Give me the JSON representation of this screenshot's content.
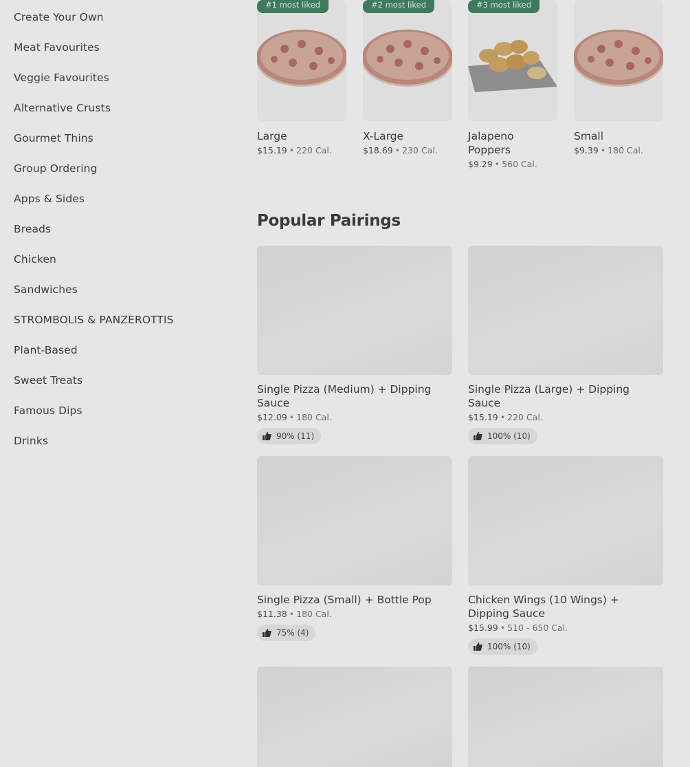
{
  "sidebar": {
    "items": [
      {
        "label": "Create Your Own"
      },
      {
        "label": "Meat Favourites"
      },
      {
        "label": "Veggie Favourites"
      },
      {
        "label": "Alternative Crusts"
      },
      {
        "label": "Gourmet Thins"
      },
      {
        "label": "Group Ordering"
      },
      {
        "label": "Apps & Sides"
      },
      {
        "label": "Breads"
      },
      {
        "label": "Chicken"
      },
      {
        "label": "Sandwiches"
      },
      {
        "label": "STROMBOLIS & PANZEROTTIS"
      },
      {
        "label": "Plant-Based"
      },
      {
        "label": "Sweet Treats"
      },
      {
        "label": "Famous Dips"
      },
      {
        "label": "Drinks"
      }
    ]
  },
  "most_liked": [
    {
      "badge": "#1 most liked",
      "name": "Large",
      "price": "$15.19",
      "cal": "220 Cal."
    },
    {
      "badge": "#2 most liked",
      "name": "X-Large",
      "price": "$18.69",
      "cal": "230 Cal."
    },
    {
      "badge": "#3 most liked",
      "name": "Jalapeno Poppers",
      "price": "$9.29",
      "cal": "560 Cal."
    },
    {
      "badge": "",
      "name": "Small",
      "price": "$9.39",
      "cal": "180 Cal."
    }
  ],
  "pairings": {
    "title": "Popular Pairings",
    "items": [
      {
        "name": "Single Pizza (Medium) + Dipping Sauce",
        "price": "$12.09",
        "cal": "180 Cal.",
        "rating": "90% (11)"
      },
      {
        "name": "Single Pizza (Large) + Dipping Sauce",
        "price": "$15.19",
        "cal": "220 Cal.",
        "rating": "100% (10)"
      },
      {
        "name": "Single Pizza (Small) + Bottle Pop",
        "price": "$11.38",
        "cal": "180 Cal.",
        "rating": "75% (4)"
      },
      {
        "name": "Chicken Wings (10 Wings) + Dipping Sauce",
        "price": "$15.99",
        "cal": "510 - 650 Cal.",
        "rating": "100% (10)"
      }
    ]
  },
  "separator": "•",
  "icons": {
    "thumbs_up": "thumbs-up-icon"
  },
  "colors": {
    "badge": "#3f7a5c",
    "background": "#e6e6e6"
  }
}
